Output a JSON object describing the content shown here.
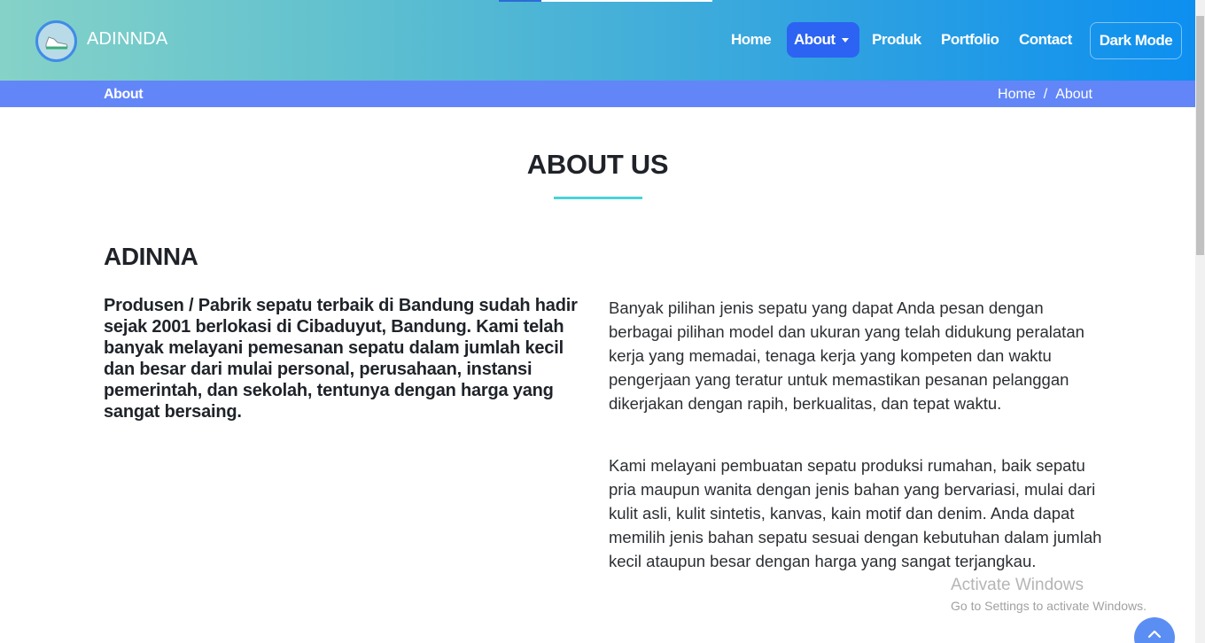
{
  "header": {
    "brand": "ADINNDA",
    "logo_icon": "shoe-logo-icon",
    "nav": {
      "home": "Home",
      "about": "About",
      "produk": "Produk",
      "portfolio": "Portfolio",
      "contact": "Contact",
      "dark_mode": "Dark Mode"
    },
    "colors": {
      "gradient_start": "#85d2c8",
      "gradient_end": "#0d8ff0",
      "active_nav": "#2c63f2"
    }
  },
  "breadcrumb": {
    "title": "About",
    "items": [
      "Home",
      "/",
      "About"
    ],
    "color": "#6286f8"
  },
  "main": {
    "section_title": "ABOUT US",
    "company_name": "ADINNA",
    "lead_text": "Produsen / Pabrik sepatu terbaik di Bandung sudah hadir sejak 2001 berlokasi di Cibaduyut, Bandung. Kami telah banyak melayani pemesanan sepatu dalam jumlah kecil dan besar dari mulai personal, perusahaan, instansi pemerintah, dan sekolah, tentunya dengan harga yang sangat bersaing.",
    "paragraph_1": "Banyak pilihan jenis sepatu yang dapat Anda pesan dengan berbagai pilihan model dan ukuran yang telah didukung peralatan kerja yang memadai, tenaga kerja yang kompeten dan waktu pengerjaan yang teratur untuk memastikan pesanan pelanggan dikerjakan dengan rapih, berkualitas, dan tepat waktu.",
    "paragraph_2": "Kami melayani pembuatan sepatu produksi rumahan, baik sepatu pria maupun wanita dengan jenis bahan yang bervariasi, mulai dari kulit asli, kulit sintetis, kanvas, kain motif dan denim. Anda dapat memilih jenis bahan sepatu sesuai dengan kebutuhan dalam jumlah kecil ataupun besar dengan harga yang sangat terjangkau.",
    "accent_color": "#47d4d6"
  },
  "watermark": {
    "title": "Activate Windows",
    "subtitle": "Go to Settings to activate Windows."
  },
  "back_to_top_icon": "chevron-up-icon"
}
